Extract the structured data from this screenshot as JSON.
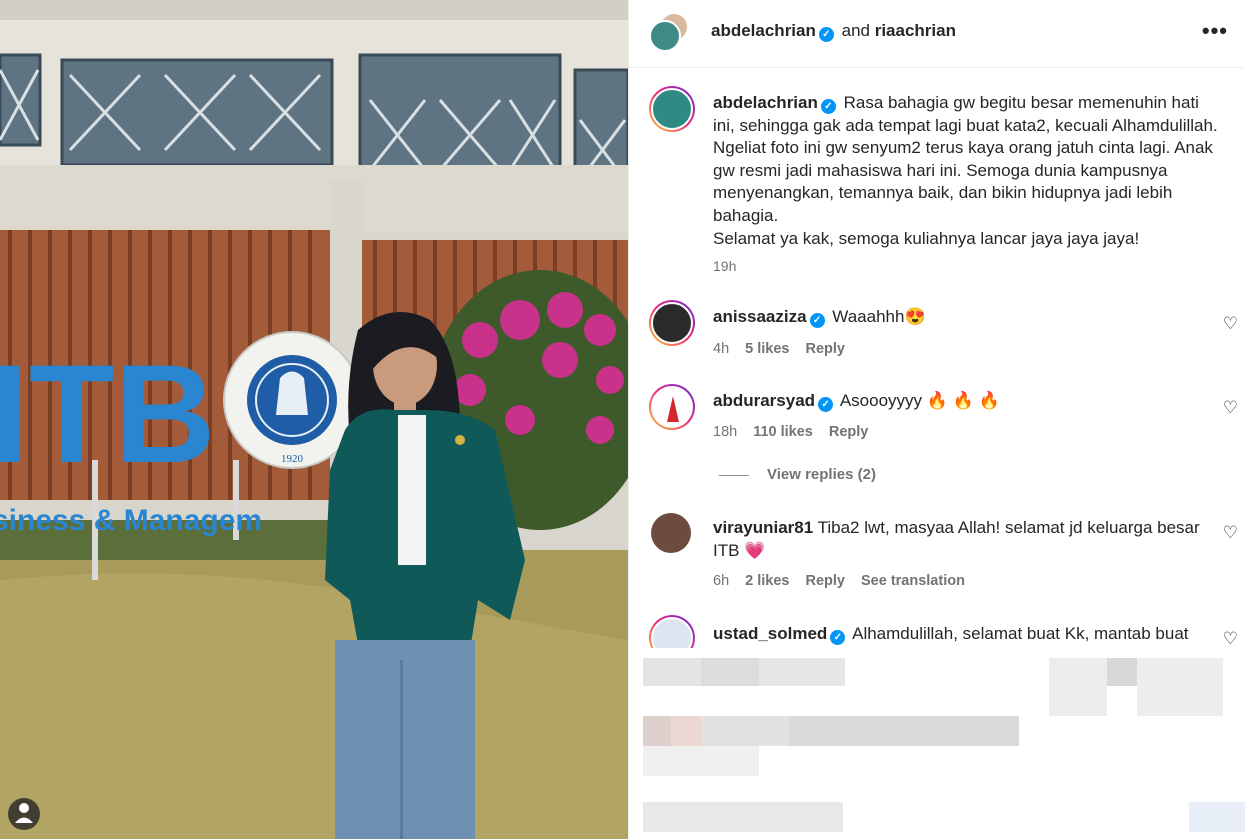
{
  "header": {
    "user1": "abdelachrian",
    "joiner": "and",
    "user2": "riaachrian",
    "more_label": "•••"
  },
  "caption": {
    "username": "abdelachrian",
    "text": "Rasa bahagia gw begitu besar memenuhin hati ini, sehingga gak ada tempat lagi buat kata2, kecuali Alhamdulillah. Ngeliat foto ini gw senyum2 terus kaya orang jatuh cinta lagi. Anak gw resmi jadi mahasiswa hari ini. Semoga dunia kampusnya menyenangkan, temannya baik, dan bikin hidupnya jadi lebih bahagia.",
    "text2": "Selamat ya kak, semoga kuliahnya lancar jaya jaya jaya!",
    "time": "19h"
  },
  "comments": [
    {
      "username": "anissaaziza",
      "verified": true,
      "text": "Waaahhh😍",
      "time": "4h",
      "likes": "5 likes",
      "reply": "Reply"
    },
    {
      "username": "abdurarsyad",
      "verified": true,
      "text": "Asoooyyyy 🔥 🔥 🔥",
      "time": "18h",
      "likes": "110 likes",
      "reply": "Reply"
    },
    {
      "username": "virayuniar81",
      "verified": false,
      "text": "Tiba2 lwt, masyaa Allah! selamat jd keluarga besar ITB 💗",
      "time": "6h",
      "likes": "2 likes",
      "reply": "Reply",
      "translate": "See translation"
    },
    {
      "username": "ustad_solmed",
      "verified": true,
      "text": "Alhamdulillah, selamat buat Kk, mantab buat"
    }
  ],
  "view_replies": "View replies (2)",
  "photo": {
    "sign_big": "ITB",
    "sign_small": "siness & Managem",
    "seal_text": "INSTITUT TEKNOLOGI BANDUNG",
    "seal_year": "1920"
  },
  "colors": {
    "verified": "#0095f6",
    "meta": "#737373",
    "jacket": "#0f5a58"
  }
}
